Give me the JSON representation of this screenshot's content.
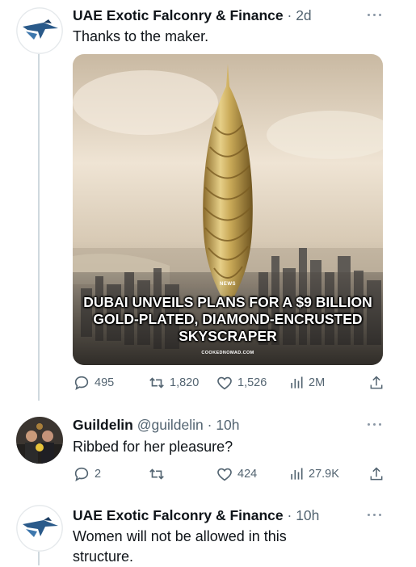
{
  "tweets": [
    {
      "author": "UAE Exotic Falconry & Finance",
      "handle": "",
      "separator": "·",
      "time": "2d",
      "text": "Thanks to the maker.",
      "media": {
        "news_tag": "NEWS",
        "headline": "DUBAI UNVEILS PLANS FOR A $9 BILLION GOLD-PLATED, DIAMOND-ENCRUSTED SKYSCRAPER",
        "site": "COOKEDNOMAD.COM"
      },
      "replies": "495",
      "retweets": "1,820",
      "likes": "1,526",
      "views": "2M"
    },
    {
      "author": "Guildelin",
      "handle": "@guildelin",
      "separator": "·",
      "time": "10h",
      "text": "Ribbed for her pleasure?",
      "replies": "2",
      "retweets": "",
      "likes": "424",
      "views": "27.9K"
    },
    {
      "author": "UAE Exotic Falconry & Finance",
      "handle": "",
      "separator": "·",
      "time": "10h",
      "text": "Women will not be allowed in this structure."
    }
  ],
  "icons": {
    "reply": "reply-icon",
    "retweet": "retweet-icon",
    "like": "heart-icon",
    "views": "views-icon",
    "share": "share-icon",
    "more": "more-icon"
  },
  "colors": {
    "text": "#0f1419",
    "muted": "#536471",
    "thread_line": "#cfd9de",
    "falcon_blue": "#2a5a8a"
  }
}
